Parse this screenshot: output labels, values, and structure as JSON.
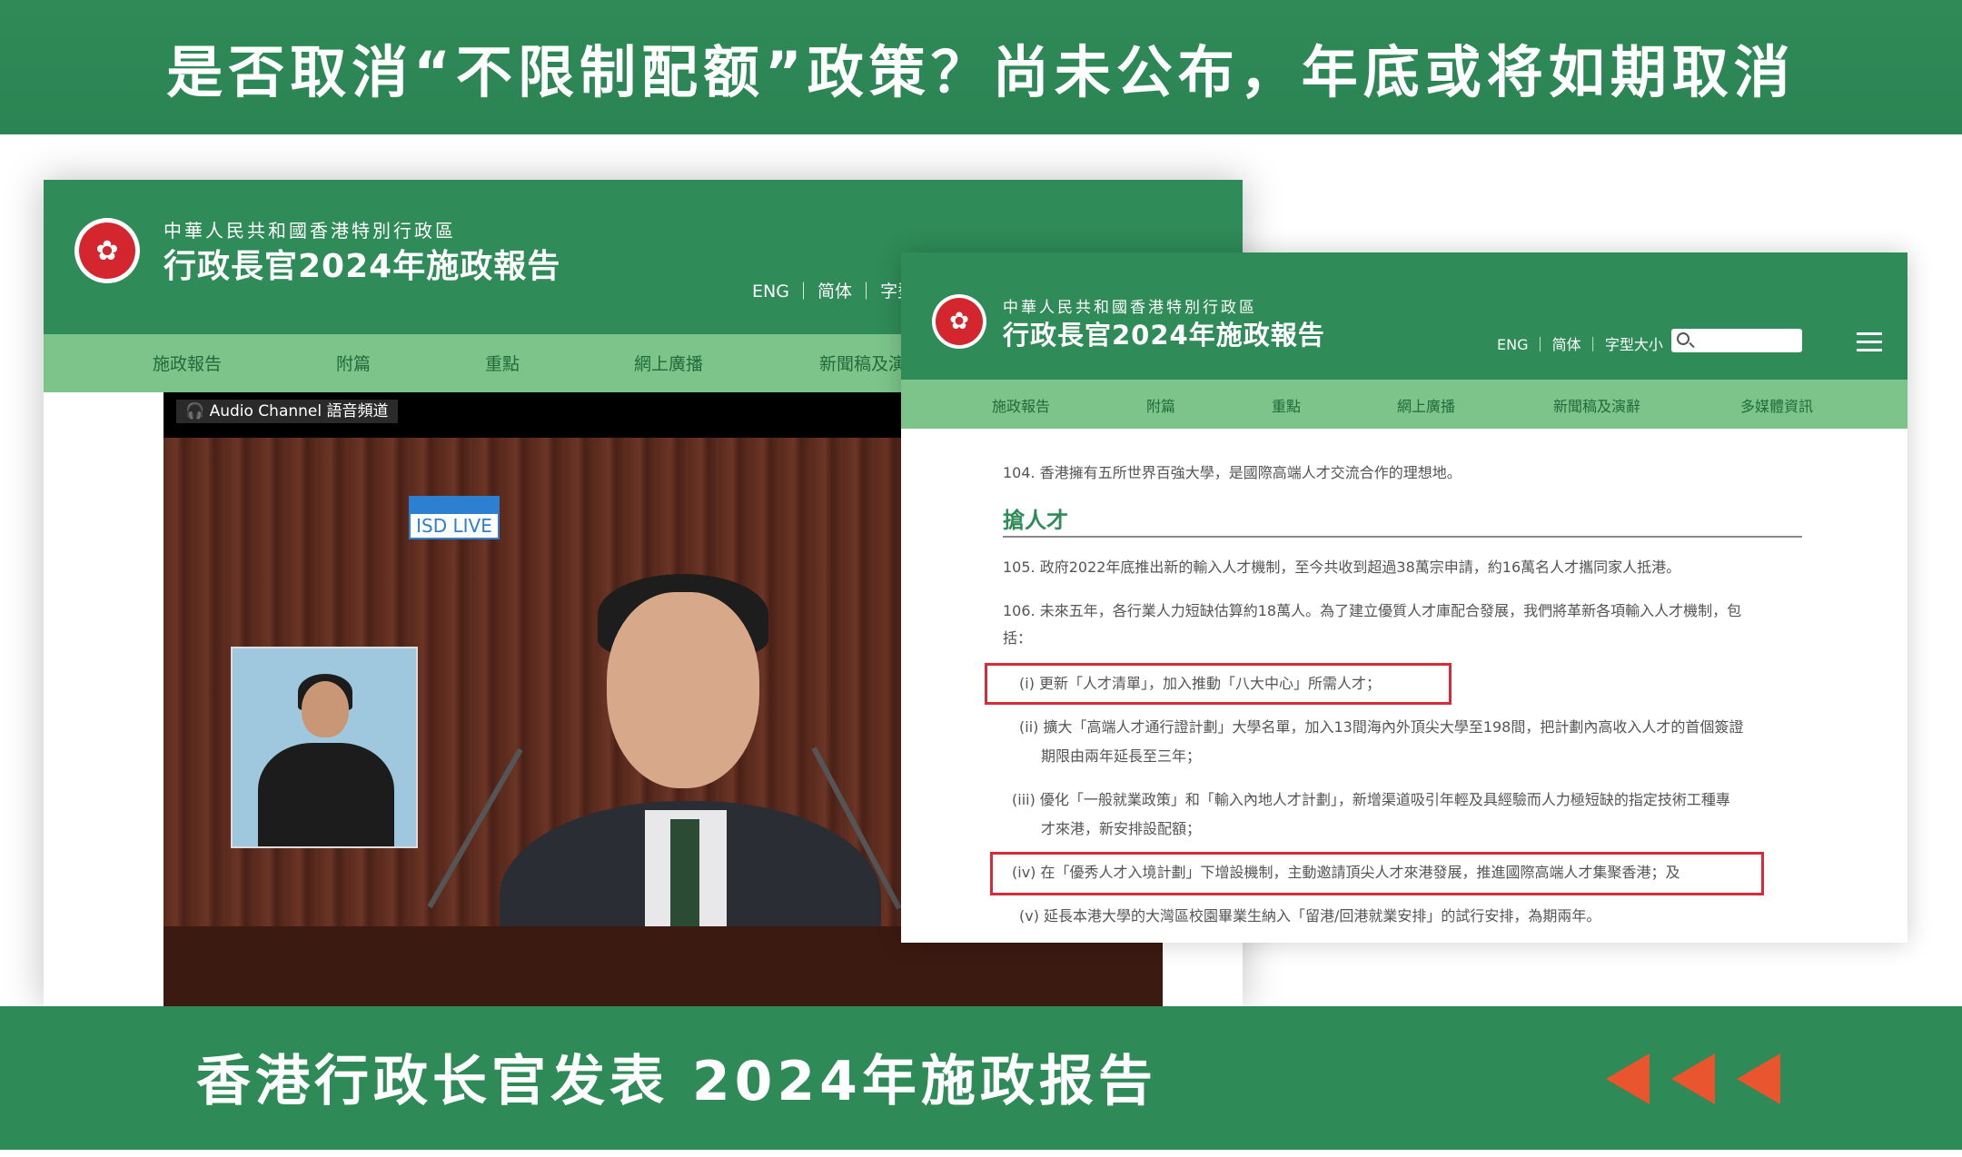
{
  "top_banner": {
    "title": "是否取消“不限制配额”政策？尚未公布，年底或将如期取消"
  },
  "bottom_banner": {
    "caption": "香港行政长官发表  2024年施政报告"
  },
  "site": {
    "subtitle": "中華人民共和國香港特別行政區",
    "title": "行政長官2024年施政報告",
    "lang_links": "ENG ｜ 简体 ｜ 字型",
    "lang_links_full": "ENG ｜ 简体 ｜ 字型大小",
    "nav_left": [
      "施政報告",
      "附篇",
      "重點",
      "網上廣播",
      "新聞稿及演"
    ],
    "nav_right": [
      "施政報告",
      "附篇",
      "重點",
      "網上廣播",
      "新聞稿及演辭",
      "多媒體資訊"
    ]
  },
  "video": {
    "audio_label": "Audio Channel 語音頻道",
    "isd_label": "ISD LIVE"
  },
  "document": {
    "p104": "104. 香港擁有五所世界百強大學，是國際高端人才交流合作的理想地。",
    "heading": "搶人才",
    "p105": "105. 政府2022年底推出新的輸入人才機制，至今共收到超過38萬宗申請，約16萬名人才攜同家人抵港。",
    "p106_line1": "106. 未來五年，各行業人力短缺估算約18萬人。為了建立優質人才庫配合發展，我們將革新各項輸入人才機制，包",
    "p106_line2": "括：",
    "item_i": "(i) 更新「人才清單」，加入推動「八大中心」所需人才；",
    "item_ii_line1": "(ii) 擴大「高端人才通行證計劃」大學名單，加入13間海內外頂尖大學至198間，把計劃內高收入人才的首個簽證",
    "item_ii_line2": "期限由兩年延長至三年；",
    "item_iii_line1": "(iii) 優化「一般就業政策」和「輸入內地人才計劃」，新增渠道吸引年輕及具經驗而人力極短缺的指定技術工種專",
    "item_iii_line2": "才來港，新安排設配額；",
    "item_iv": "(iv) 在「優秀人才入境計劃」下增設機制，主動邀請頂尖人才來港發展，推進國際高端人才集聚香港；及",
    "item_v": "(v) 延長本港大學的大灣區校園畢業生納入「留港/回港就業安排」的試行安排，為期兩年。"
  },
  "colors": {
    "brand_green": "#2f8b58",
    "nav_green": "#7cc48a",
    "highlight_red": "#d62b3a",
    "arrow_orange": "#e8552e"
  },
  "icons": [
    "hk-emblem-icon",
    "headphones-icon",
    "search-icon",
    "hamburger-menu-icon",
    "arrow-left-icon"
  ]
}
